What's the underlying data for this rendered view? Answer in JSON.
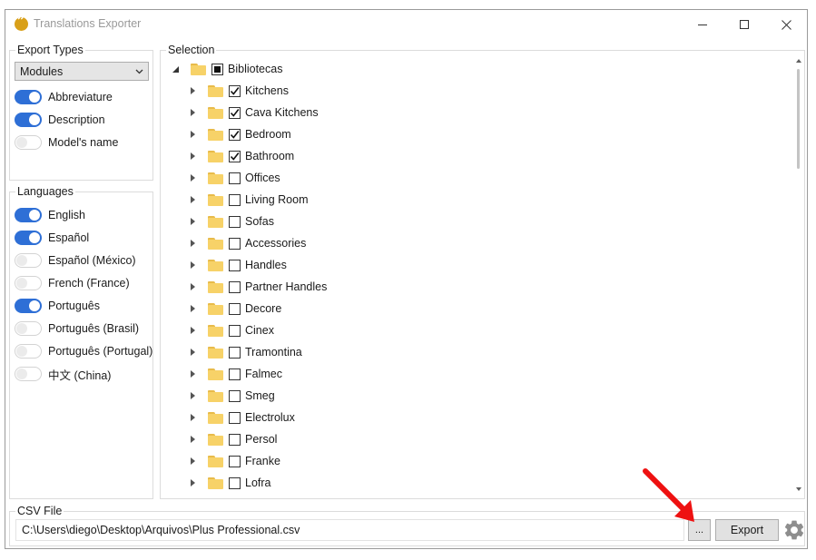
{
  "window": {
    "title": "Translations Exporter",
    "accent": "#2e6fd6"
  },
  "export_types": {
    "label": "Export Types",
    "dropdown_value": "Modules",
    "toggles": [
      {
        "label": "Abbreviature",
        "on": true
      },
      {
        "label": "Description",
        "on": true
      },
      {
        "label": "Model's name",
        "on": false
      }
    ]
  },
  "languages": {
    "label": "Languages",
    "toggles": [
      {
        "label": "English",
        "on": true
      },
      {
        "label": "Español",
        "on": true
      },
      {
        "label": "Español (México)",
        "on": false
      },
      {
        "label": "French (France)",
        "on": false
      },
      {
        "label": "Português",
        "on": true
      },
      {
        "label": "Português (Brasil)",
        "on": false
      },
      {
        "label": "Português (Portugal)",
        "on": false
      },
      {
        "label": "中文 (China)",
        "on": false
      }
    ]
  },
  "selection": {
    "label": "Selection",
    "root": {
      "label": "Bibliotecas",
      "state": "partial"
    },
    "items": [
      {
        "label": "Kitchens",
        "checked": true
      },
      {
        "label": "Cava Kitchens",
        "checked": true
      },
      {
        "label": "Bedroom",
        "checked": true
      },
      {
        "label": "Bathroom",
        "checked": true
      },
      {
        "label": "Offices",
        "checked": false
      },
      {
        "label": "Living Room",
        "checked": false
      },
      {
        "label": "Sofas",
        "checked": false
      },
      {
        "label": "Accessories",
        "checked": false
      },
      {
        "label": "Handles",
        "checked": false
      },
      {
        "label": "Partner Handles",
        "checked": false
      },
      {
        "label": "Decore",
        "checked": false
      },
      {
        "label": "Cinex",
        "checked": false
      },
      {
        "label": "Tramontina",
        "checked": false
      },
      {
        "label": "Falmec",
        "checked": false
      },
      {
        "label": "Smeg",
        "checked": false
      },
      {
        "label": "Electrolux",
        "checked": false
      },
      {
        "label": "Persol",
        "checked": false
      },
      {
        "label": "Franke",
        "checked": false
      },
      {
        "label": "Lofra",
        "checked": false
      }
    ]
  },
  "csv": {
    "label": "CSV File",
    "path": "C:\\Users\\diego\\Desktop\\Arquivos\\Plus Professional.csv",
    "browse_label": "...",
    "export_label": "Export"
  }
}
